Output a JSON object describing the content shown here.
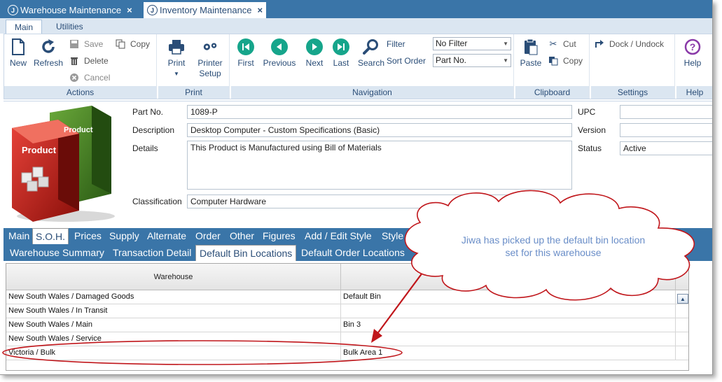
{
  "doc_tabs": [
    {
      "label": "Warehouse Maintenance",
      "close": "×",
      "active": false
    },
    {
      "label": "Inventory Maintenance",
      "close": "×",
      "active": true
    }
  ],
  "doc_tab_icon": "J",
  "ribbon_tabs": [
    "Main",
    "Utilities"
  ],
  "ribbon": {
    "actions": {
      "label": "Actions",
      "new": "New",
      "refresh": "Refresh",
      "save": "Save",
      "delete": "Delete",
      "cancel": "Cancel",
      "copy": "Copy"
    },
    "print": {
      "label": "Print",
      "print": "Print",
      "printer_setup_1": "Printer",
      "printer_setup_2": "Setup"
    },
    "navigation": {
      "label": "Navigation",
      "first": "First",
      "previous": "Previous",
      "next": "Next",
      "last": "Last",
      "search": "Search",
      "filter_label": "Filter",
      "filter_value": "No Filter",
      "sort_label": "Sort Order",
      "sort_value": "Part No."
    },
    "clipboard": {
      "label": "Clipboard",
      "paste": "Paste",
      "cut": "Cut",
      "copy": "Copy"
    },
    "settings": {
      "label": "Settings",
      "dock": "Dock / Undock"
    },
    "help": {
      "label": "Help",
      "help": "Help"
    }
  },
  "product_image_text": [
    "Product",
    "Product"
  ],
  "fields": {
    "part_no": {
      "label": "Part No.",
      "value": "1089-P"
    },
    "description": {
      "label": "Description",
      "value": "Desktop Computer  - Custom Specifications (Basic)"
    },
    "details": {
      "label": "Details",
      "value": "This Product is Manufactured using Bill of Materials"
    },
    "classification": {
      "label": "Classification",
      "value": "Computer Hardware"
    },
    "upc": {
      "label": "UPC",
      "value": ""
    },
    "version": {
      "label": "Version",
      "value": ""
    },
    "status": {
      "label": "Status",
      "value": "Active"
    }
  },
  "section_tabs": [
    "Main",
    "S.O.H.",
    "Prices",
    "Supply",
    "Alternate",
    "Order",
    "Other",
    "Figures",
    "Add / Edit Style",
    "Style SO"
  ],
  "sub_tabs": [
    "Warehouse Summary",
    "Transaction Detail",
    "Default Bin Locations",
    "Default Order Locations"
  ],
  "grid": {
    "headers": [
      "Warehouse",
      ""
    ],
    "rows": [
      [
        "New South Wales / Damaged Goods",
        "Default Bin"
      ],
      [
        "New South Wales / In Transit",
        ""
      ],
      [
        "New South Wales / Main",
        "Bin 3"
      ],
      [
        "New South Wales / Service",
        ""
      ],
      [
        "Victoria / Bulk",
        "Bulk Area 1"
      ]
    ]
  },
  "callout": {
    "line1": "Jiwa has picked up the default bin location",
    "line2": "set for this warehouse"
  },
  "colors": {
    "accent": "#3a75a8",
    "ribbon_light": "#dbe6f1",
    "nav_green": "#16a58b",
    "help_purple": "#8a3aa8",
    "annotation_red": "#c0161b"
  }
}
